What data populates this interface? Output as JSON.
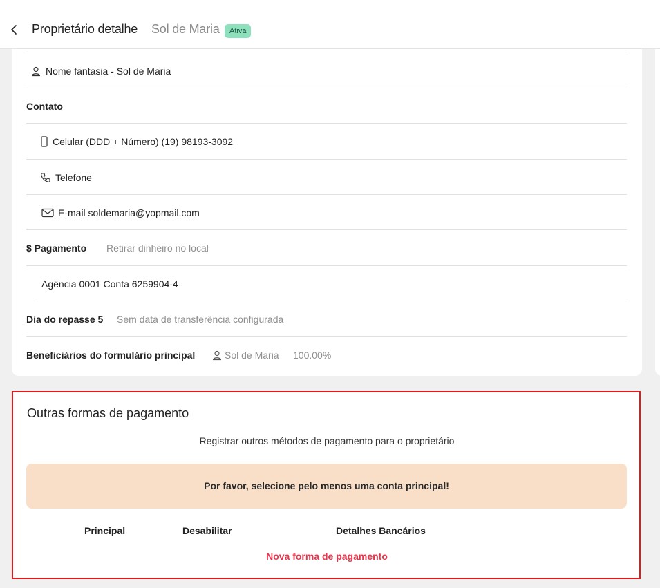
{
  "header": {
    "title": "Proprietário detalhe",
    "subtitle": "Sol de Maria",
    "status_badge": "Ativa"
  },
  "details": {
    "trade_name": "Nome fantasia - Sol de Maria",
    "contact_heading": "Contato",
    "cell": "Celular (DDD + Número) (19) 98193-3092",
    "phone": "Telefone",
    "email": "E-mail soldemaria@yopmail.com",
    "payment_label": "$ Pagamento",
    "payment_method": "Retirar dinheiro no local",
    "bank_account": "Agência 0001 Conta 6259904-4",
    "transfer_day_label": "Dia do repasse 5",
    "transfer_day_value": "Sem data de transferência configurada",
    "beneficiaries_label": "Beneficiários do formulário principal",
    "beneficiary_name": "Sol de Maria",
    "beneficiary_percent": "100.00%"
  },
  "other_payments": {
    "title": "Outras formas de pagamento",
    "description": "Registrar outros métodos de pagamento para o proprietário",
    "warning": "Por favor, selecione pelo menos uma conta principal!",
    "columns": [
      "Principal",
      "Desabilitar",
      "Detalhes Bancários"
    ],
    "new_payment": "Nova forma de pagamento"
  },
  "colors": {
    "badge_bg": "#8ee0bd",
    "warning_bg": "#fadfc8",
    "link_red": "#e8354c",
    "highlight_border": "#e01b1b"
  },
  "icons": [
    "chevron-left-icon",
    "user-icon",
    "mobile-icon",
    "phone-icon",
    "mail-icon",
    "user-icon"
  ]
}
